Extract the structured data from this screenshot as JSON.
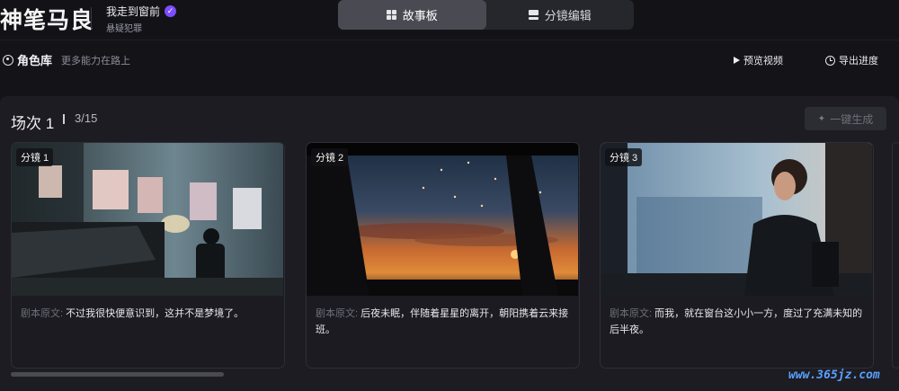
{
  "header": {
    "logo_text": "神笔马良",
    "project_title": "我走到窗前",
    "project_genre": "悬疑犯罪",
    "tabs": [
      {
        "label": "故事板",
        "icon": "grid-icon",
        "active": true
      },
      {
        "label": "分镜编辑",
        "icon": "panel-icon",
        "active": false
      }
    ]
  },
  "toolbar": {
    "role_library": "角色库",
    "more_ability": "更多能力在路上",
    "preview_video": "预览视频",
    "export_progress": "导出进度"
  },
  "scene": {
    "title": "场次 1",
    "count": "3/15",
    "generate_label": "一键生成"
  },
  "cards": [
    {
      "shot": "分镜 1",
      "script_prefix": "剧本原文:",
      "script_text": "不过我很快便意识到，这并不是梦境了。"
    },
    {
      "shot": "分镜 2",
      "script_prefix": "剧本原文:",
      "script_text": "后夜未眠，伴随着星星的离开，朝阳携着云来接班。"
    },
    {
      "shot": "分镜 3",
      "script_prefix": "剧本原文:",
      "script_text": "而我，就在窗台这小小一方，度过了充满未知的后半夜。"
    }
  ],
  "watermark": "www.365jz.com",
  "colors": {
    "background": "#131318",
    "panel": "#1c1c22",
    "accent": "#7c4dff",
    "active_tab": "#4a4a52"
  }
}
